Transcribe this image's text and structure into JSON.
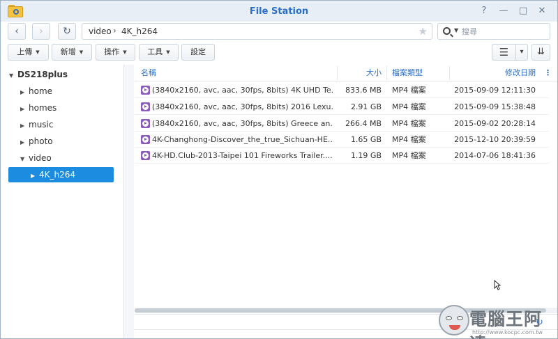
{
  "window": {
    "title": "File Station",
    "controls": {
      "help": "?",
      "minimize": "—",
      "maximize": "□",
      "close": "✕"
    }
  },
  "nav": {
    "back": "‹",
    "forward": "›",
    "refresh": "↻",
    "path": [
      "video",
      "4K_h264"
    ],
    "path_separator": "›",
    "favorite": "★",
    "search_placeholder": "搜尋"
  },
  "toolbar": {
    "upload": "上傳",
    "create": "新增",
    "action": "操作",
    "tools": "工具",
    "settings": "設定",
    "view_list": "☰",
    "view_caret": "▾",
    "sort": "⇊"
  },
  "tree": {
    "root": "DS218plus",
    "items": [
      {
        "label": "home",
        "expanded": false
      },
      {
        "label": "homes",
        "expanded": false
      },
      {
        "label": "music",
        "expanded": false
      },
      {
        "label": "photo",
        "expanded": false
      },
      {
        "label": "video",
        "expanded": true
      },
      {
        "label": "4K_h264",
        "expanded": false,
        "selected": true
      }
    ]
  },
  "list": {
    "columns": {
      "name": "名稱",
      "size": "大小",
      "type": "檔案類型",
      "modified": "修改日期"
    },
    "rows": [
      {
        "name": "(3840x2160, avc, aac, 30fps, 8bits) 4K UHD Te...",
        "size": "833.6 MB",
        "type": "MP4 檔案",
        "modified": "2015-09-09 12:11:30"
      },
      {
        "name": "(3840x2160, avc, aac, 30fps, 8bits) 2016 Lexu...",
        "size": "2.91 GB",
        "type": "MP4 檔案",
        "modified": "2015-09-09 15:38:48"
      },
      {
        "name": "(3840x2160, avc, aac, 30fps, 8bits) Greece an...",
        "size": "266.4 MB",
        "type": "MP4 檔案",
        "modified": "2015-09-02 20:28:14"
      },
      {
        "name": "4K-Changhong-Discover_the_true_Sichuan-HE...",
        "size": "1.65 GB",
        "type": "MP4 檔案",
        "modified": "2015-12-10 20:39:59"
      },
      {
        "name": "4K-HD.Club-2013-Taipei 101 Fireworks Trailer....",
        "size": "1.19 GB",
        "type": "MP4 檔案",
        "modified": "2014-07-06 18:41:36"
      }
    ],
    "column_menu": "⋮"
  },
  "watermark": {
    "text": "電腦王阿達",
    "url": "http://www.kocpc.com.tw"
  },
  "colors": {
    "accent": "#2c6fc7",
    "selected": "#1c8ce0",
    "video_icon": "#8c5cbc"
  }
}
